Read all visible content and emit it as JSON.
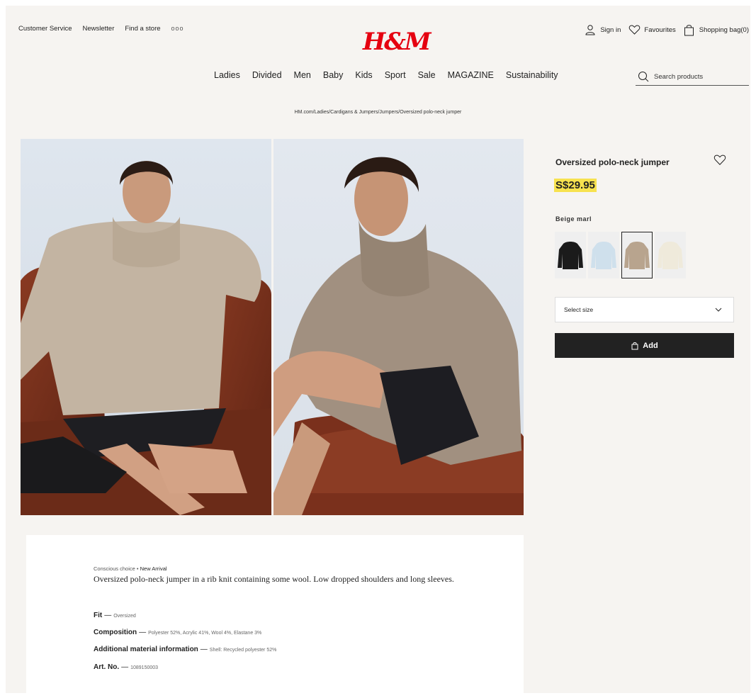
{
  "brand": {
    "logo": "H&M",
    "logo_color": "#e50010"
  },
  "utility": {
    "customer_service": "Customer Service",
    "newsletter": "Newsletter",
    "find_store": "Find a store",
    "more": "ooo",
    "sign_in": "Sign in",
    "favourites": "Favourites",
    "shopping_bag": "Shopping bag(0)"
  },
  "nav": {
    "items": [
      "Ladies",
      "Divided",
      "Men",
      "Baby",
      "Kids",
      "Sport",
      "Sale",
      "MAGAZINE",
      "Sustainability"
    ]
  },
  "search": {
    "placeholder": "Search products"
  },
  "breadcrumb": "HM.com/Ladies/Cardigans & Jumpers/Jumpers/Oversized polo-neck jumper",
  "product": {
    "title": "Oversized polo-neck jumper",
    "price": "S$29.95",
    "price_highlight": "#f7e24f",
    "colour_label": "Beige marl",
    "swatches": [
      {
        "name": "black",
        "color": "#1b1b1b",
        "selected": false
      },
      {
        "name": "light-blue",
        "color": "#cfe0ec",
        "selected": false
      },
      {
        "name": "beige-marl",
        "color": "#b8a48e",
        "selected": true
      },
      {
        "name": "cream",
        "color": "#efeadb",
        "selected": false
      }
    ],
    "size_select": "Select size",
    "add_button": "Add"
  },
  "description": {
    "tag_1": "Conscious choice",
    "tag_separator": "•",
    "tag_2": "New Arrival",
    "text": "Oversized polo-neck jumper in a rib knit containing some wool. Low dropped shoulders and long sleeves.",
    "specs": [
      {
        "label": "Fit",
        "value": "Oversized"
      },
      {
        "label": "Composition",
        "value": "Polyester 52%, Acrylic 41%, Wool 4%, Elastane 3%"
      },
      {
        "label": "Additional material information",
        "value": "Shell: Recycled polyester 52%"
      },
      {
        "label": "Art. No.",
        "value": "1089150003"
      }
    ],
    "dash": "—"
  }
}
